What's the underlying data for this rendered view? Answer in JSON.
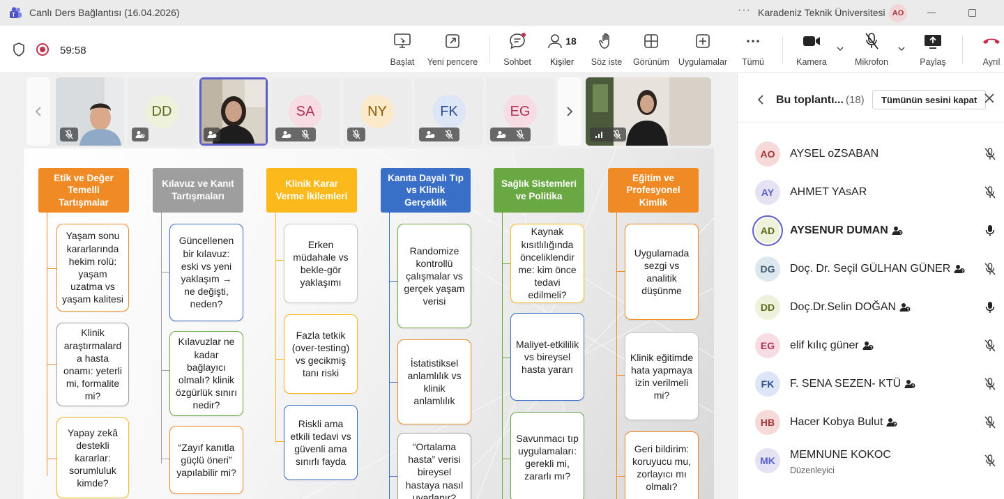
{
  "window": {
    "title": "Canlı Ders Bağlantısı (16.04.2026)",
    "org": "Karadeniz Teknik Üniversitesi",
    "user_initials": "AO",
    "more": "···"
  },
  "meeting": {
    "timer": "59:58"
  },
  "toolbar": {
    "items": [
      {
        "label": "Başlat"
      },
      {
        "label": "Yeni pencere"
      },
      {
        "label": "Sohbet"
      },
      {
        "label": "Kişiler",
        "count": "18"
      },
      {
        "label": "Söz iste"
      },
      {
        "label": "Görünüm"
      },
      {
        "label": "Uygulamalar"
      },
      {
        "label": "Tümü"
      },
      {
        "label": "Kamera"
      },
      {
        "label": "Mikrofon"
      },
      {
        "label": "Paylaş"
      },
      {
        "label": "Ayrıl"
      }
    ]
  },
  "tiles": [
    {
      "type": "video",
      "initials": ""
    },
    {
      "type": "avatar",
      "initials": "DD"
    },
    {
      "type": "video",
      "initials": ""
    },
    {
      "type": "avatar",
      "initials": "SA"
    },
    {
      "type": "avatar",
      "initials": "NY"
    },
    {
      "type": "avatar",
      "initials": "FK"
    },
    {
      "type": "avatar",
      "initials": "EG"
    }
  ],
  "slide": {
    "columns": [
      {
        "title": "Etik ve Değer Temelli Tartışmalar",
        "color": "#f08a24",
        "cards": [
          "Yaşam sonu kararlarında hekim rolü: yaşam uzatma vs yaşam kalitesi",
          "Klinik araştırmalard a hasta onamı: yeterli mi, formalite mi?",
          "Yapay zekâ destekli kararlar: sorumluluk kimde?"
        ]
      },
      {
        "title": "Kılavuz ve Kanıt Tartışmaları",
        "color": "#9e9e9e",
        "cards": [
          "Güncellenen bir kılavuz: eski vs yeni yaklaşım → ne değişti, neden?",
          "Kılavuzlar ne kadar bağlayıcı olmalı? klinik özgürlük sınırı nedir?",
          "“Zayıf kanıtla güçlü öneri” yapılabilir mi?"
        ]
      },
      {
        "title": "Klinik Karar Verme İkilemleri",
        "color": "#fbb91c",
        "cards": [
          "Erken müdahale vs bekle-gör yaklaşımı",
          "Fazla tetkik (over-testing) vs gecikmiş tanı riski",
          "Riskli ama etkili tedavi vs güvenli ama sınırlı fayda"
        ]
      },
      {
        "title": "Kanıta Dayalı Tıp vs Klinik Gerçeklik",
        "color": "#3a6fc8",
        "cards": [
          "Randomize kontrollü çalışmalar vs gerçek yaşam verisi",
          "İstatistiksel anlamlılık vs klinik anlamlılık",
          "“Ortalama hasta” verisi bireysel hastaya nasıl uyarlanır?"
        ]
      },
      {
        "title": "Sağlık Sistemleri ve Politika",
        "color": "#6aa843",
        "cards": [
          "Kaynak kısıtlılığında önceliklendir me: kim önce tedavi edilmeli?",
          "Maliyet-etkililik vs bireysel hasta yararı",
          "Savunmacı tıp uygulamaları: gerekli mi, zararlı mı?"
        ]
      },
      {
        "title": "Eğitim ve Profesyonel Kimlik",
        "color": "#f08a24",
        "cards": [
          "Uygulamada sezgi vs analitik düşünme",
          "Klinik eğitimde hata yapmaya izin verilmeli mi?",
          "Geri bildirim: koruyucu mu, zorlayıcı mı olmalı?"
        ]
      }
    ]
  },
  "panel": {
    "title": "Bu toplantı...",
    "count": "(18)",
    "mute_all": "Tümünün sesini kapat",
    "participants": [
      {
        "initials": "AO",
        "name": "AYSEL oZSABAN",
        "guest": false,
        "mic": "off",
        "av_bg": "#f6d9d9",
        "av_fg": "#a4373a"
      },
      {
        "initials": "AY",
        "name": "AHMET YAsAR",
        "guest": false,
        "mic": "off",
        "av_bg": "#e4e2f3",
        "av_fg": "#5b5fc7"
      },
      {
        "initials": "AD",
        "name": "AYSENUR DUMAN",
        "guest": true,
        "mic": "on",
        "av_bg": "#eef2da",
        "av_fg": "#5c6b1f",
        "speaking": true
      },
      {
        "initials": "DG",
        "name": "Doç. Dr. Seçil GÜLHAN GÜNER",
        "guest": true,
        "mic": "off",
        "av_bg": "#dde7ee",
        "av_fg": "#3d5a70"
      },
      {
        "initials": "DD",
        "name": "Doç.Dr.Selin DOĞAN",
        "guest": true,
        "mic": "on",
        "av_bg": "#eef2da",
        "av_fg": "#5c6b1f"
      },
      {
        "initials": "EG",
        "name": "elif kılıç güner",
        "guest": true,
        "mic": "off",
        "av_bg": "#f7dce4",
        "av_fg": "#b0345a"
      },
      {
        "initials": "FK",
        "name": "F. SENA SEZEN- KTÜ",
        "guest": true,
        "mic": "off",
        "av_bg": "#dde6f6",
        "av_fg": "#2b4f8c"
      },
      {
        "initials": "HB",
        "name": "Hacer Kobya Bulut",
        "guest": true,
        "mic": "off",
        "av_bg": "#f6d9d9",
        "av_fg": "#a4373a"
      },
      {
        "initials": "MK",
        "name": "MEMNUNE KOKOC",
        "sub": "Düzenleyici",
        "guest": false,
        "mic": "off",
        "av_bg": "#e4e2f3",
        "av_fg": "#5b5fc7"
      }
    ]
  }
}
